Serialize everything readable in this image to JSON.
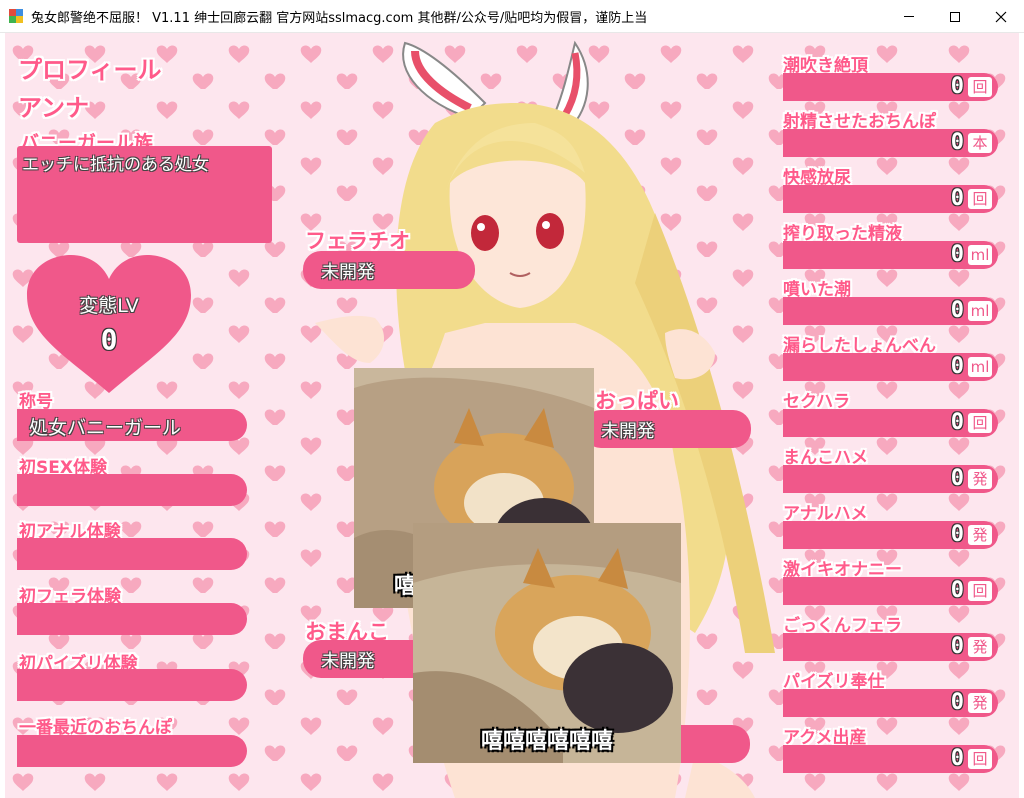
{
  "window": {
    "title": "兔女郎警绝不屈服！ V1.11 绅士回廊云翻 官方网站sslmacg.com 其他群/公众号/贴吧均为假冒，谨防上当"
  },
  "profile": {
    "heading": "プロフィール",
    "name": "アンナ",
    "race": "バニーガール族",
    "description": "エッチに抵抗のある処女",
    "hentai_label": "変態LV",
    "hentai_value": "0",
    "title_label": "称号",
    "title_value": "処女バニーガール",
    "first_sex_label": "初SEX体験",
    "first_anal_label": "初アナル体験",
    "first_fellatio_label": "初フェラ体験",
    "first_paizuri_label": "初パイズリ体験",
    "latest_label": "一番最近のおちんぽ"
  },
  "development": {
    "fellatio_label": "フェラチオ",
    "fellatio_value": "未開発",
    "oppai_label": "おっぱい",
    "oppai_value": "未開発",
    "omanko_label": "おまんこ",
    "omanko_value": "未開発"
  },
  "stats": [
    {
      "label": "潮吹き絶頂",
      "value": "0",
      "unit": "回"
    },
    {
      "label": "射精させたおちんぽ",
      "value": "0",
      "unit": "本"
    },
    {
      "label": "快感放尿",
      "value": "0",
      "unit": "回"
    },
    {
      "label": "搾り取った精液",
      "value": "0",
      "unit": "ml"
    },
    {
      "label": "噴いた潮",
      "value": "0",
      "unit": "ml"
    },
    {
      "label": "漏らしたしょんべん",
      "value": "0",
      "unit": "ml"
    },
    {
      "label": "セクハラ",
      "value": "0",
      "unit": "回"
    },
    {
      "label": "まんこハメ",
      "value": "0",
      "unit": "発"
    },
    {
      "label": "アナルハメ",
      "value": "0",
      "unit": "発"
    },
    {
      "label": "激イキオナニー",
      "value": "0",
      "unit": "回"
    },
    {
      "label": "ごっくんフェラ",
      "value": "0",
      "unit": "発"
    },
    {
      "label": "パイズリ奉仕",
      "value": "0",
      "unit": "発"
    },
    {
      "label": "アクメ出産",
      "value": "0",
      "unit": "回"
    }
  ],
  "meme": {
    "caption": "嘻嘻嘻嘻嘻嘻",
    "caption_partial": "嘻"
  },
  "colors": {
    "accent": "#f0588a",
    "background": "#fde6ee",
    "heart": "#f7a9bf"
  }
}
